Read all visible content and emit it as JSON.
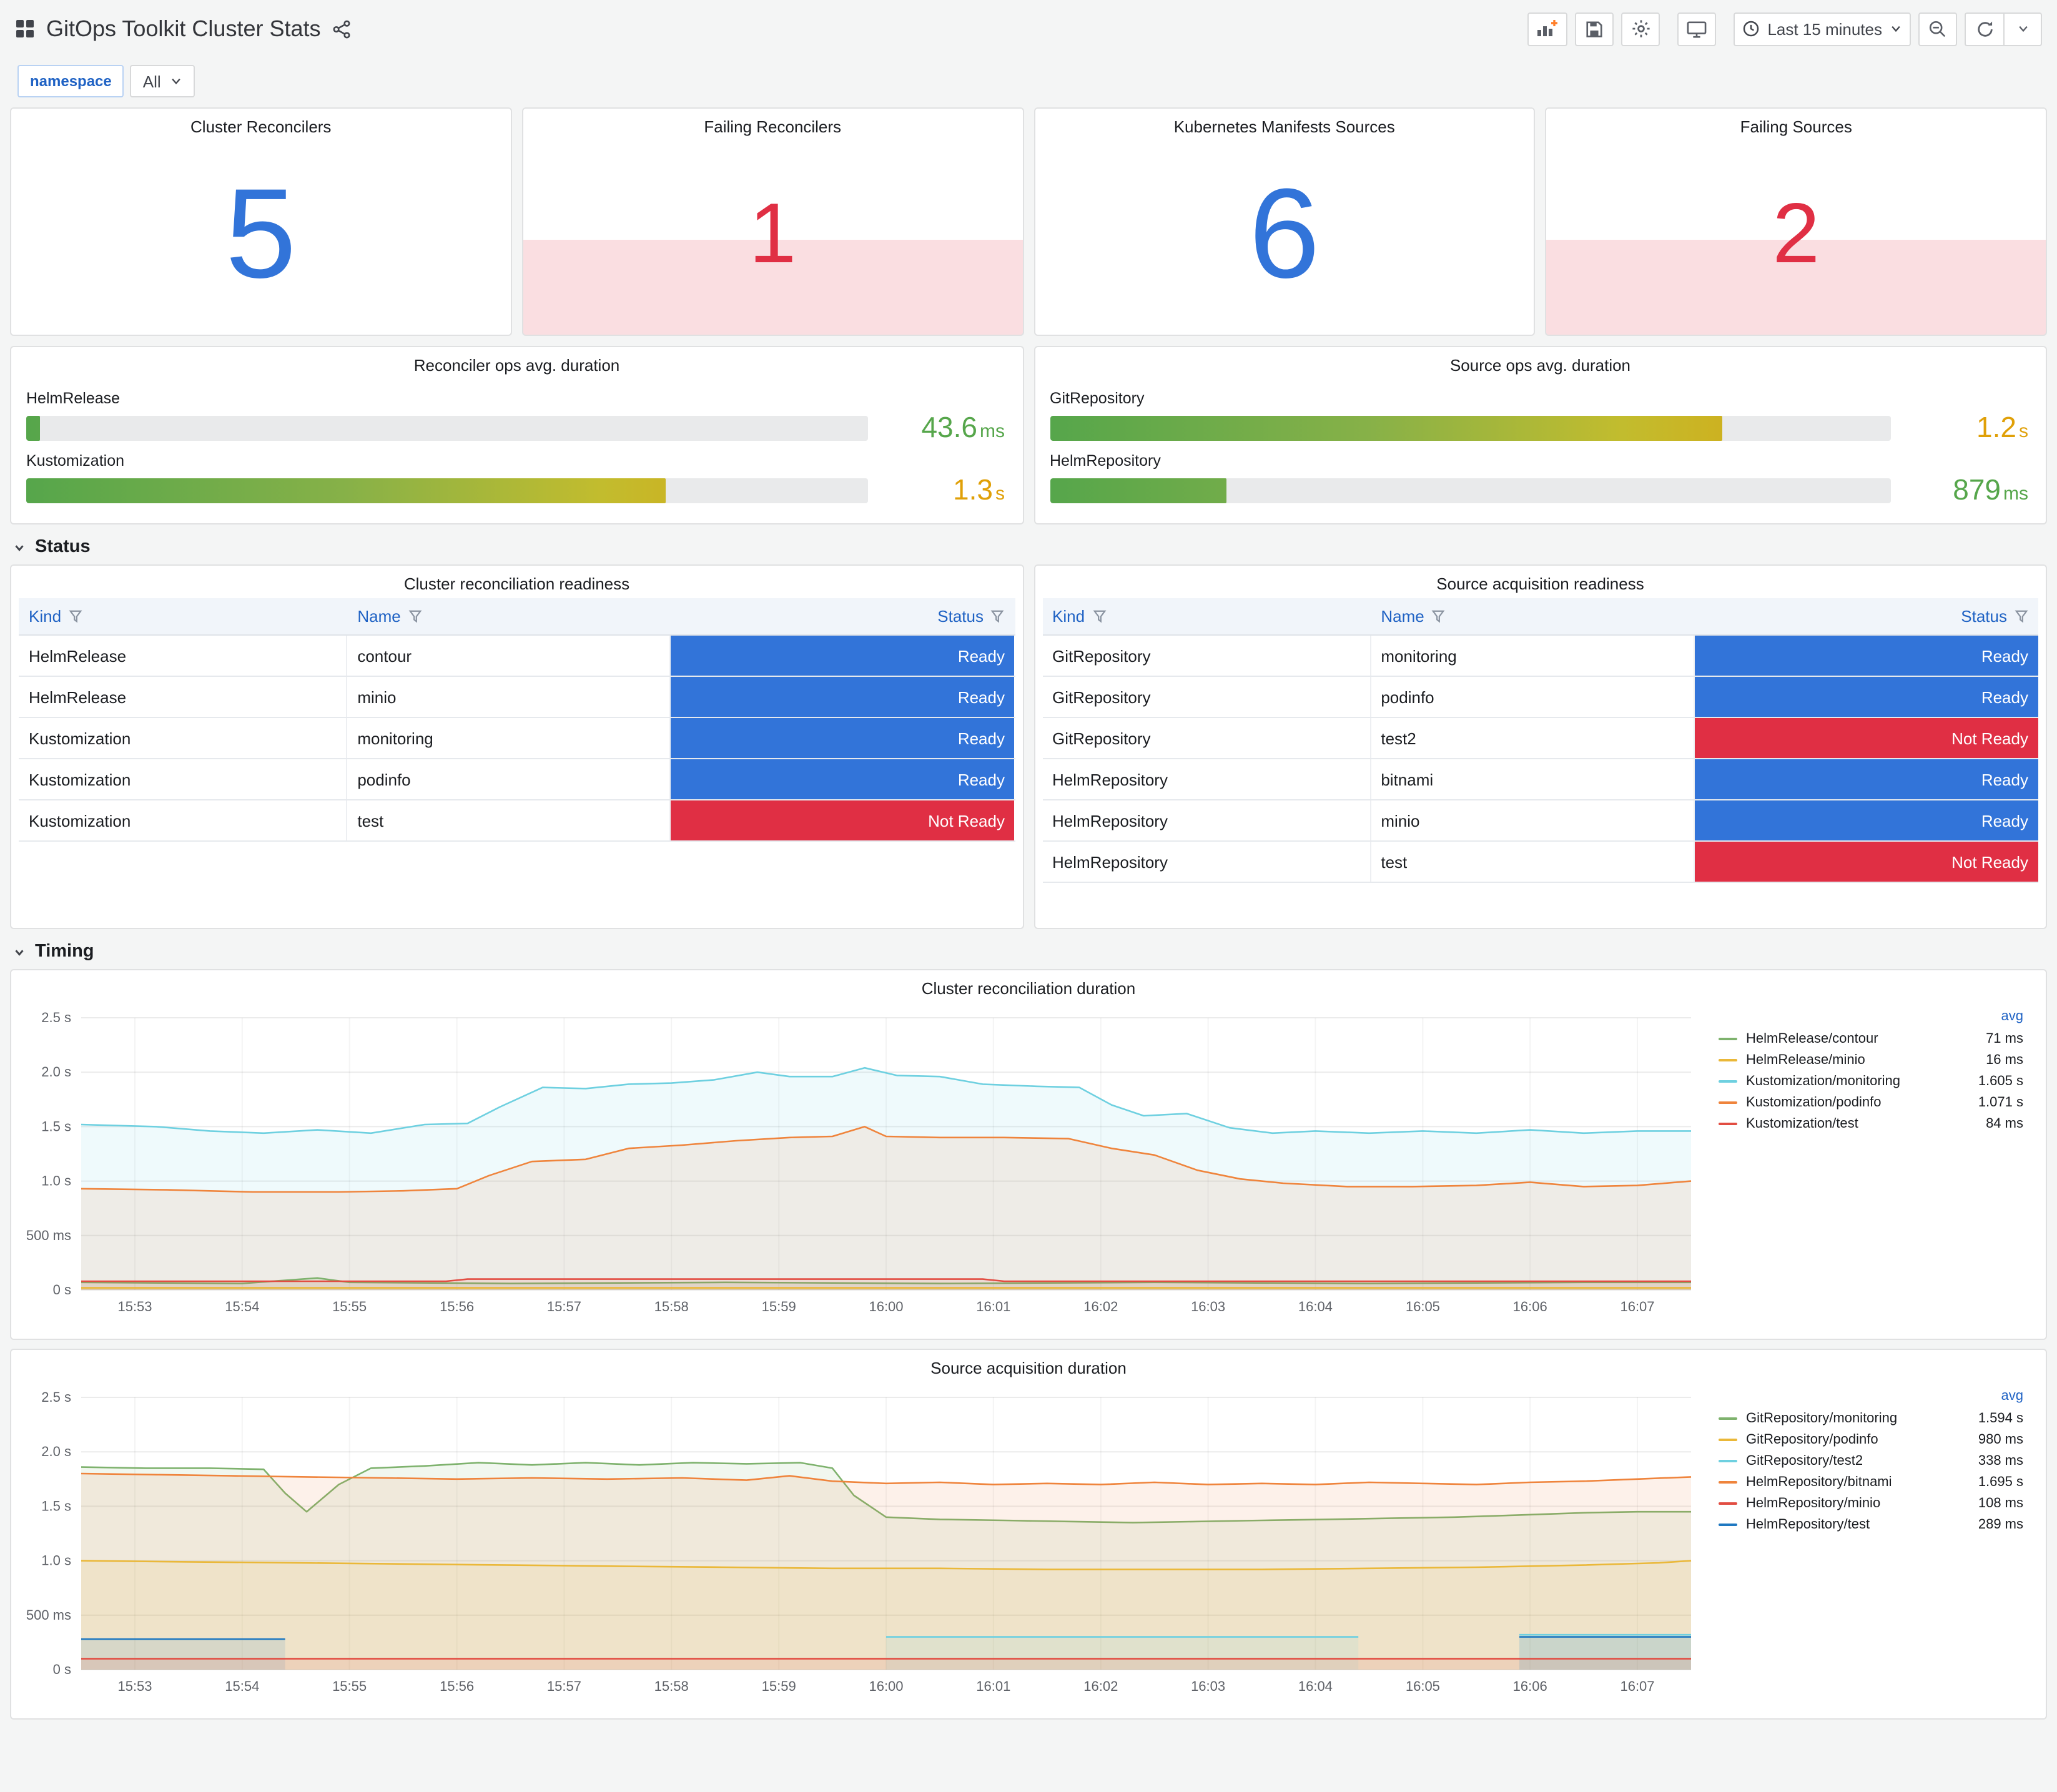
{
  "header": {
    "title": "GitOps Toolkit Cluster Stats"
  },
  "toolbar": {
    "time_range": "Last 15 minutes"
  },
  "variables": {
    "name": "namespace",
    "value": "All"
  },
  "sections": {
    "status": "Status",
    "timing": "Timing"
  },
  "colors": {
    "blue": "#3274d9",
    "red": "#e02f44",
    "alert_bg": "rgba(224,47,68,0.16)",
    "ready": "#3274d9",
    "not_ready": "#e02f44"
  },
  "stat_panels": [
    {
      "title": "Cluster Reconcilers",
      "value": "5",
      "state": "ok"
    },
    {
      "title": "Failing Reconcilers",
      "value": "1",
      "state": "alert"
    },
    {
      "title": "Kubernetes Manifests Sources",
      "value": "6",
      "state": "ok"
    },
    {
      "title": "Failing Sources",
      "value": "2",
      "state": "alert"
    }
  ],
  "gauge_panels": [
    {
      "title": "Reconciler ops avg. duration",
      "bars": [
        {
          "label": "HelmRelease",
          "value": "43.6",
          "unit": "ms",
          "pct": 1.6,
          "value_color": "#56a64b"
        },
        {
          "label": "Kustomization",
          "value": "1.3",
          "unit": "s",
          "pct": 76,
          "value_color": "#e0a008"
        }
      ]
    },
    {
      "title": "Source ops avg. duration",
      "bars": [
        {
          "label": "GitRepository",
          "value": "1.2",
          "unit": "s",
          "pct": 80,
          "value_color": "#e0a008"
        },
        {
          "label": "HelmRepository",
          "value": "879",
          "unit": "ms",
          "pct": 21,
          "value_color": "#56a64b"
        }
      ]
    }
  ],
  "tables": [
    {
      "title": "Cluster reconciliation readiness",
      "columns": [
        "Kind",
        "Name",
        "Status"
      ],
      "rows": [
        {
          "kind": "HelmRelease",
          "name": "contour",
          "status": "Ready"
        },
        {
          "kind": "HelmRelease",
          "name": "minio",
          "status": "Ready"
        },
        {
          "kind": "Kustomization",
          "name": "monitoring",
          "status": "Ready"
        },
        {
          "kind": "Kustomization",
          "name": "podinfo",
          "status": "Ready"
        },
        {
          "kind": "Kustomization",
          "name": "test",
          "status": "Not Ready"
        }
      ]
    },
    {
      "title": "Source acquisition readiness",
      "columns": [
        "Kind",
        "Name",
        "Status"
      ],
      "rows": [
        {
          "kind": "GitRepository",
          "name": "monitoring",
          "status": "Ready"
        },
        {
          "kind": "GitRepository",
          "name": "podinfo",
          "status": "Ready"
        },
        {
          "kind": "GitRepository",
          "name": "test2",
          "status": "Not Ready"
        },
        {
          "kind": "HelmRepository",
          "name": "bitnami",
          "status": "Ready"
        },
        {
          "kind": "HelmRepository",
          "name": "minio",
          "status": "Ready"
        },
        {
          "kind": "HelmRepository",
          "name": "test",
          "status": "Not Ready"
        }
      ]
    }
  ],
  "chart_data": [
    {
      "type": "line",
      "title": "Cluster reconciliation duration",
      "legend_header": "avg",
      "legend_position": "right",
      "grid": true,
      "ylim": [
        0,
        2.5
      ],
      "xlim": [
        0,
        15
      ],
      "yticks": [
        {
          "v": 0,
          "label": "0 s"
        },
        {
          "v": 0.5,
          "label": "500 ms"
        },
        {
          "v": 1.0,
          "label": "1.0 s"
        },
        {
          "v": 1.5,
          "label": "1.5 s"
        },
        {
          "v": 2.0,
          "label": "2.0 s"
        },
        {
          "v": 2.5,
          "label": "2.5 s"
        }
      ],
      "xtick_labels": [
        "15:53",
        "15:54",
        "15:55",
        "15:56",
        "15:57",
        "15:58",
        "15:59",
        "16:00",
        "16:01",
        "16:02",
        "16:03",
        "16:04",
        "16:05",
        "16:06",
        "16:07"
      ],
      "series": [
        {
          "name": "HelmRelease/contour",
          "color": "#7EB26D",
          "avg": "71 ms",
          "points": [
            [
              0,
              0.07
            ],
            [
              1.5,
              0.06
            ],
            [
              2.2,
              0.11
            ],
            [
              2.5,
              0.07
            ],
            [
              4,
              0.06
            ],
            [
              6,
              0.07
            ],
            [
              8,
              0.06
            ],
            [
              10,
              0.07
            ],
            [
              12,
              0.06
            ],
            [
              14,
              0.07
            ],
            [
              15,
              0.07
            ]
          ]
        },
        {
          "name": "HelmRelease/minio",
          "color": "#EAB839",
          "avg": "16 ms",
          "points": [
            [
              0,
              0.02
            ],
            [
              15,
              0.02
            ]
          ]
        },
        {
          "name": "Kustomization/monitoring",
          "color": "#6ED0E0",
          "avg": "1.605 s",
          "points": [
            [
              0,
              1.52
            ],
            [
              0.7,
              1.5
            ],
            [
              1.2,
              1.46
            ],
            [
              1.7,
              1.44
            ],
            [
              2.2,
              1.47
            ],
            [
              2.7,
              1.44
            ],
            [
              3.2,
              1.52
            ],
            [
              3.6,
              1.53
            ],
            [
              3.9,
              1.68
            ],
            [
              4.3,
              1.86
            ],
            [
              4.7,
              1.85
            ],
            [
              5.1,
              1.89
            ],
            [
              5.5,
              1.9
            ],
            [
              5.9,
              1.93
            ],
            [
              6.3,
              2.0
            ],
            [
              6.6,
              1.96
            ],
            [
              7.0,
              1.96
            ],
            [
              7.3,
              2.04
            ],
            [
              7.6,
              1.97
            ],
            [
              8.0,
              1.96
            ],
            [
              8.4,
              1.89
            ],
            [
              8.9,
              1.87
            ],
            [
              9.3,
              1.86
            ],
            [
              9.6,
              1.7
            ],
            [
              9.9,
              1.6
            ],
            [
              10.3,
              1.62
            ],
            [
              10.7,
              1.49
            ],
            [
              11.1,
              1.44
            ],
            [
              11.5,
              1.46
            ],
            [
              12.0,
              1.44
            ],
            [
              12.5,
              1.46
            ],
            [
              13.0,
              1.44
            ],
            [
              13.5,
              1.47
            ],
            [
              14.0,
              1.44
            ],
            [
              14.5,
              1.46
            ],
            [
              15,
              1.46
            ]
          ]
        },
        {
          "name": "Kustomization/podinfo",
          "color": "#EF843C",
          "avg": "1.071 s",
          "points": [
            [
              0,
              0.93
            ],
            [
              0.8,
              0.92
            ],
            [
              1.6,
              0.9
            ],
            [
              2.4,
              0.9
            ],
            [
              3.0,
              0.91
            ],
            [
              3.5,
              0.93
            ],
            [
              3.8,
              1.05
            ],
            [
              4.2,
              1.18
            ],
            [
              4.7,
              1.2
            ],
            [
              5.1,
              1.3
            ],
            [
              5.6,
              1.33
            ],
            [
              6.1,
              1.37
            ],
            [
              6.6,
              1.4
            ],
            [
              7.0,
              1.41
            ],
            [
              7.3,
              1.5
            ],
            [
              7.5,
              1.41
            ],
            [
              8.0,
              1.4
            ],
            [
              8.6,
              1.4
            ],
            [
              9.2,
              1.39
            ],
            [
              9.6,
              1.3
            ],
            [
              10.0,
              1.24
            ],
            [
              10.4,
              1.1
            ],
            [
              10.8,
              1.02
            ],
            [
              11.2,
              0.98
            ],
            [
              11.8,
              0.95
            ],
            [
              12.4,
              0.95
            ],
            [
              13.0,
              0.96
            ],
            [
              13.5,
              0.99
            ],
            [
              14.0,
              0.95
            ],
            [
              14.5,
              0.96
            ],
            [
              15,
              1.0
            ]
          ]
        },
        {
          "name": "Kustomization/test",
          "color": "#E24D42",
          "avg": "84 ms",
          "points": [
            [
              0,
              0.08
            ],
            [
              3.4,
              0.08
            ],
            [
              3.6,
              0.1
            ],
            [
              8.4,
              0.1
            ],
            [
              8.6,
              0.08
            ],
            [
              15,
              0.08
            ]
          ]
        }
      ]
    },
    {
      "type": "line",
      "title": "Source acquisition duration",
      "legend_header": "avg",
      "legend_position": "right",
      "grid": true,
      "ylim": [
        0,
        2.5
      ],
      "xlim": [
        0,
        15
      ],
      "yticks": [
        {
          "v": 0,
          "label": "0 s"
        },
        {
          "v": 0.5,
          "label": "500 ms"
        },
        {
          "v": 1.0,
          "label": "1.0 s"
        },
        {
          "v": 1.5,
          "label": "1.5 s"
        },
        {
          "v": 2.0,
          "label": "2.0 s"
        },
        {
          "v": 2.5,
          "label": "2.5 s"
        }
      ],
      "xtick_labels": [
        "15:53",
        "15:54",
        "15:55",
        "15:56",
        "15:57",
        "15:58",
        "15:59",
        "16:00",
        "16:01",
        "16:02",
        "16:03",
        "16:04",
        "16:05",
        "16:06",
        "16:07"
      ],
      "series": [
        {
          "name": "GitRepository/monitoring",
          "color": "#7EB26D",
          "avg": "1.594 s",
          "points": [
            [
              0,
              1.86
            ],
            [
              0.6,
              1.85
            ],
            [
              1.2,
              1.85
            ],
            [
              1.7,
              1.84
            ],
            [
              1.9,
              1.62
            ],
            [
              2.1,
              1.45
            ],
            [
              2.4,
              1.7
            ],
            [
              2.7,
              1.85
            ],
            [
              3.2,
              1.87
            ],
            [
              3.7,
              1.9
            ],
            [
              4.2,
              1.88
            ],
            [
              4.7,
              1.9
            ],
            [
              5.2,
              1.88
            ],
            [
              5.7,
              1.9
            ],
            [
              6.2,
              1.89
            ],
            [
              6.7,
              1.9
            ],
            [
              7.0,
              1.85
            ],
            [
              7.2,
              1.6
            ],
            [
              7.5,
              1.4
            ],
            [
              8.0,
              1.38
            ],
            [
              8.6,
              1.37
            ],
            [
              9.2,
              1.36
            ],
            [
              9.8,
              1.35
            ],
            [
              10.4,
              1.36
            ],
            [
              11.0,
              1.37
            ],
            [
              11.6,
              1.38
            ],
            [
              12.2,
              1.39
            ],
            [
              12.8,
              1.4
            ],
            [
              13.4,
              1.42
            ],
            [
              14.0,
              1.44
            ],
            [
              14.5,
              1.45
            ],
            [
              15,
              1.45
            ]
          ]
        },
        {
          "name": "GitRepository/podinfo",
          "color": "#EAB839",
          "avg": "980 ms",
          "points": [
            [
              0,
              1.0
            ],
            [
              1,
              0.99
            ],
            [
              2,
              0.98
            ],
            [
              3,
              0.97
            ],
            [
              4,
              0.96
            ],
            [
              5,
              0.95
            ],
            [
              6,
              0.94
            ],
            [
              7,
              0.93
            ],
            [
              8,
              0.93
            ],
            [
              9,
              0.92
            ],
            [
              10,
              0.92
            ],
            [
              11,
              0.92
            ],
            [
              12,
              0.93
            ],
            [
              13,
              0.94
            ],
            [
              14,
              0.96
            ],
            [
              14.7,
              0.98
            ],
            [
              15,
              1.0
            ]
          ]
        },
        {
          "name": "GitRepository/test2",
          "color": "#6ED0E0",
          "avg": "338 ms",
          "points": [
            [
              7.5,
              0.3
            ],
            [
              11.9,
              0.3
            ],
            null,
            [
              13.4,
              0.32
            ],
            [
              15,
              0.32
            ]
          ]
        },
        {
          "name": "HelmRepository/bitnami",
          "color": "#EF843C",
          "avg": "1.695 s",
          "points": [
            [
              0,
              1.8
            ],
            [
              0.7,
              1.79
            ],
            [
              1.4,
              1.78
            ],
            [
              2.1,
              1.77
            ],
            [
              2.8,
              1.76
            ],
            [
              3.5,
              1.75
            ],
            [
              4.2,
              1.76
            ],
            [
              4.9,
              1.75
            ],
            [
              5.6,
              1.76
            ],
            [
              6.2,
              1.74
            ],
            [
              6.6,
              1.78
            ],
            [
              7.0,
              1.73
            ],
            [
              7.5,
              1.71
            ],
            [
              8.0,
              1.72
            ],
            [
              8.5,
              1.7
            ],
            [
              9.0,
              1.71
            ],
            [
              9.5,
              1.7
            ],
            [
              10.0,
              1.72
            ],
            [
              10.5,
              1.7
            ],
            [
              11.0,
              1.71
            ],
            [
              11.5,
              1.7
            ],
            [
              12.0,
              1.72
            ],
            [
              12.5,
              1.71
            ],
            [
              13.0,
              1.7
            ],
            [
              13.5,
              1.72
            ],
            [
              14.0,
              1.73
            ],
            [
              14.5,
              1.75
            ],
            [
              15,
              1.77
            ]
          ]
        },
        {
          "name": "HelmRepository/minio",
          "color": "#E24D42",
          "avg": "108 ms",
          "points": [
            [
              0,
              0.1
            ],
            [
              15,
              0.1
            ]
          ]
        },
        {
          "name": "HelmRepository/test",
          "color": "#1F78C1",
          "avg": "289 ms",
          "points": [
            [
              0,
              0.28
            ],
            [
              1.9,
              0.28
            ],
            null,
            [
              13.4,
              0.3
            ],
            [
              15,
              0.3
            ]
          ]
        }
      ]
    }
  ]
}
